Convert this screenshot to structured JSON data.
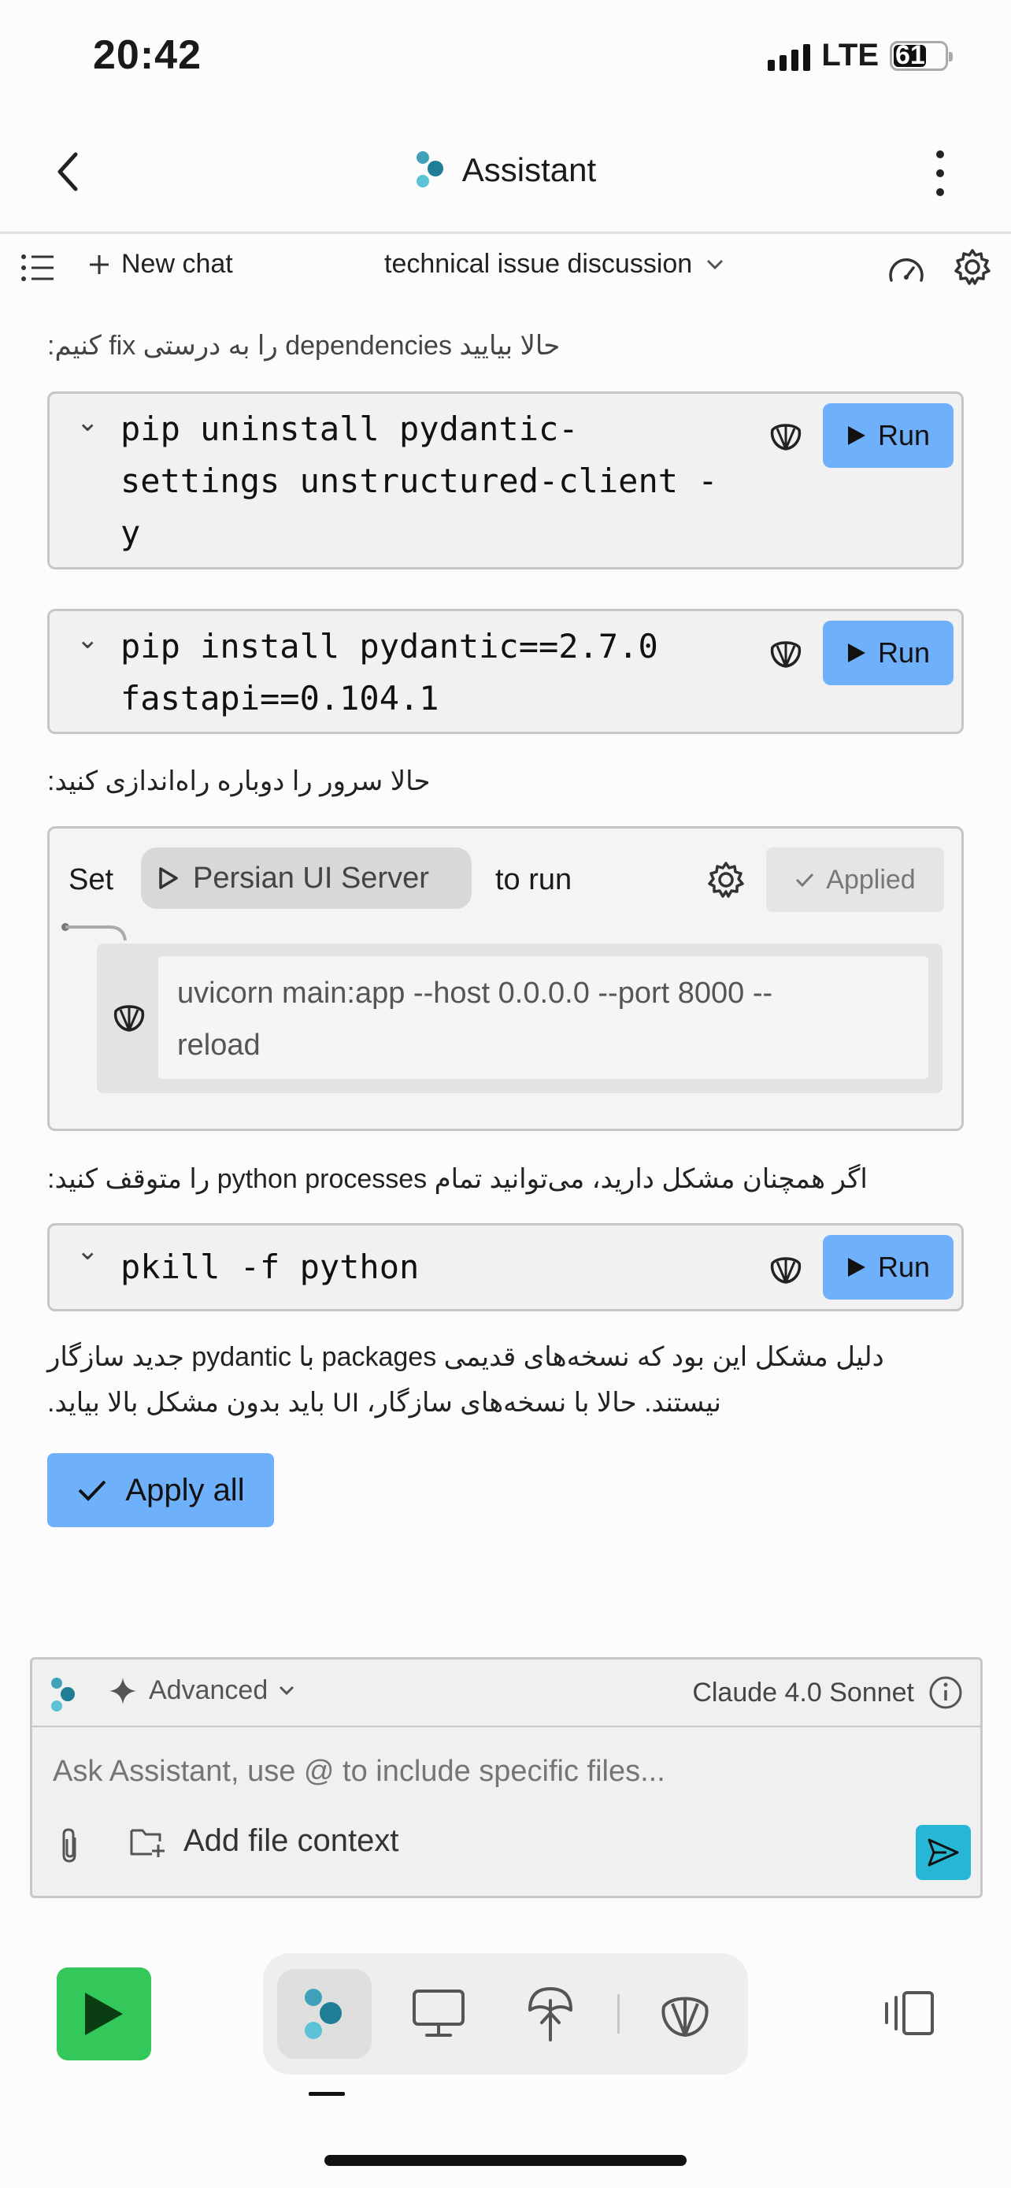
{
  "status_bar": {
    "time": "20:42",
    "network": "LTE",
    "battery": "61"
  },
  "header": {
    "title": "Assistant"
  },
  "toolbar": {
    "new_chat": "New chat",
    "conversation_title": "technical issue discussion"
  },
  "messages": {
    "intro": "حالا بیایید dependencies را به درستی fix کنیم:",
    "code1_lines": [
      "pip uninstall pydantic-",
      "settings unstructured-client -",
      "y"
    ],
    "code2_lines": [
      "pip install pydantic==2.7.0",
      "fastapi==0.104.1"
    ],
    "restart_text": "حالا سرور را دوباره راه‌اندازی کنید:",
    "run_config": {
      "set_label": "Set",
      "server_name": "Persian UI Server",
      "to_run_label": "to run",
      "applied_label": "Applied",
      "command_lines": [
        "uvicorn main:app --host 0.0.0.0 --port 8000 --",
        "reload"
      ]
    },
    "kill_text": "اگر همچنان مشکل دارید، می‌توانید تمام python processes را متوقف کنید:",
    "code3_lines": [
      "pkill -f python"
    ],
    "summary_line1": "دلیل مشکل این بود که نسخه‌های قدیمی packages با pydantic جدید سازگار",
    "summary_line2": "نیستند. حالا با نسخه‌های سازگار، UI باید بدون مشکل بالا بیاید.",
    "run_label": "Run",
    "apply_all": "Apply all"
  },
  "composer": {
    "mode": "Advanced",
    "model": "Claude 4.0 Sonnet",
    "placeholder": "Ask Assistant, use @ to include specific files...",
    "add_context": "Add file context"
  },
  "colors": {
    "accent_blue": "#6fb0fb",
    "play_green": "#34c759",
    "send_teal": "#28b6d6"
  }
}
